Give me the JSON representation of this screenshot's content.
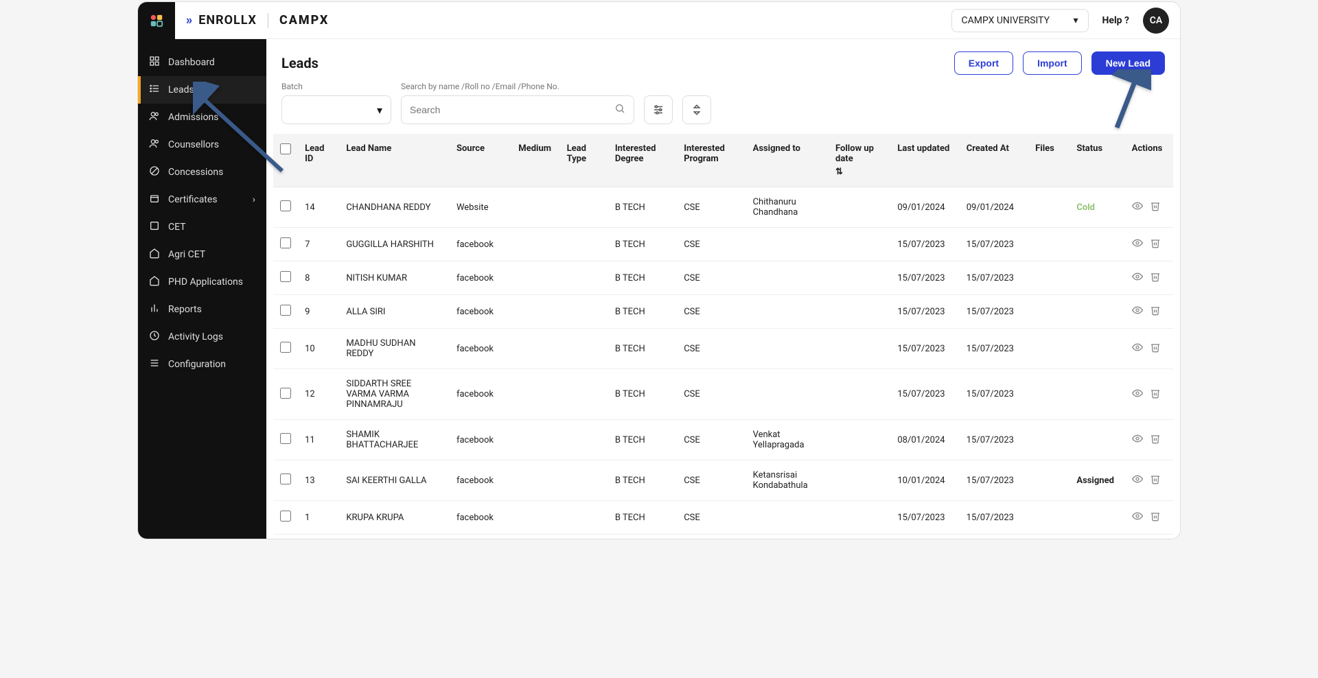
{
  "header": {
    "brand_prefix": "ENROLLX",
    "brand_suffix": "CAMPX",
    "university_label": "CAMPX UNIVERSITY",
    "help_label": "Help ?",
    "avatar_initials": "CA"
  },
  "sidebar": {
    "items": [
      {
        "label": "Dashboard",
        "icon": "grid"
      },
      {
        "label": "Leads",
        "icon": "list",
        "active": true
      },
      {
        "label": "Admissions",
        "icon": "users"
      },
      {
        "label": "Counsellors",
        "icon": "users"
      },
      {
        "label": "Concessions",
        "icon": "slash"
      },
      {
        "label": "Certificates",
        "icon": "box",
        "chevron": true
      },
      {
        "label": "CET",
        "icon": "square"
      },
      {
        "label": "Agri CET",
        "icon": "home"
      },
      {
        "label": "PHD Applications",
        "icon": "home"
      },
      {
        "label": "Reports",
        "icon": "bar"
      },
      {
        "label": "Activity Logs",
        "icon": "clock"
      },
      {
        "label": "Configuration",
        "icon": "sliders"
      }
    ]
  },
  "page": {
    "title": "Leads",
    "export_label": "Export",
    "import_label": "Import",
    "newlead_label": "New Lead"
  },
  "filters": {
    "batch_label": "Batch",
    "search_label": "Search by name /Roll no /Email /Phone No.",
    "search_placeholder": "Search"
  },
  "table": {
    "columns": [
      "",
      "Lead ID",
      "Lead Name",
      "Source",
      "Medium",
      "Lead Type",
      "Interested Degree",
      "Interested Program",
      "Assigned to",
      "Follow up date",
      "Last updated",
      "Created At",
      "Files",
      "Status",
      "Actions"
    ],
    "rows": [
      {
        "id": "14",
        "name": "CHANDHANA REDDY",
        "source": "Website",
        "medium": "",
        "type": "",
        "degree": "B TECH",
        "program": "CSE",
        "assigned": "Chithanuru Chandhana",
        "follow": "",
        "updated": "09/01/2024",
        "created": "09/01/2024",
        "files": "",
        "status": "Cold",
        "status_class": "status-cold"
      },
      {
        "id": "7",
        "name": "GUGGILLA HARSHITH",
        "source": "facebook",
        "medium": "",
        "type": "",
        "degree": "B TECH",
        "program": "CSE",
        "assigned": "",
        "follow": "",
        "updated": "15/07/2023",
        "created": "15/07/2023",
        "files": "",
        "status": "",
        "status_class": ""
      },
      {
        "id": "8",
        "name": "NITISH KUMAR",
        "source": "facebook",
        "medium": "",
        "type": "",
        "degree": "B TECH",
        "program": "CSE",
        "assigned": "",
        "follow": "",
        "updated": "15/07/2023",
        "created": "15/07/2023",
        "files": "",
        "status": "",
        "status_class": ""
      },
      {
        "id": "9",
        "name": "ALLA SIRI",
        "source": "facebook",
        "medium": "",
        "type": "",
        "degree": "B TECH",
        "program": "CSE",
        "assigned": "",
        "follow": "",
        "updated": "15/07/2023",
        "created": "15/07/2023",
        "files": "",
        "status": "",
        "status_class": ""
      },
      {
        "id": "10",
        "name": "MADHU SUDHAN REDDY",
        "source": "facebook",
        "medium": "",
        "type": "",
        "degree": "B TECH",
        "program": "CSE",
        "assigned": "",
        "follow": "",
        "updated": "15/07/2023",
        "created": "15/07/2023",
        "files": "",
        "status": "",
        "status_class": ""
      },
      {
        "id": "12",
        "name": "SIDDARTH SREE VARMA VARMA PINNAMRAJU",
        "source": "facebook",
        "medium": "",
        "type": "",
        "degree": "B TECH",
        "program": "CSE",
        "assigned": "",
        "follow": "",
        "updated": "15/07/2023",
        "created": "15/07/2023",
        "files": "",
        "status": "",
        "status_class": ""
      },
      {
        "id": "11",
        "name": "SHAMIK BHATTACHARJEE",
        "source": "facebook",
        "medium": "",
        "type": "",
        "degree": "B TECH",
        "program": "CSE",
        "assigned": "Venkat Yellapragada",
        "follow": "",
        "updated": "08/01/2024",
        "created": "15/07/2023",
        "files": "",
        "status": "",
        "status_class": ""
      },
      {
        "id": "13",
        "name": "SAI KEERTHI GALLA",
        "source": "facebook",
        "medium": "",
        "type": "",
        "degree": "B TECH",
        "program": "CSE",
        "assigned": "Ketansrisai Kondabathula",
        "follow": "",
        "updated": "10/01/2024",
        "created": "15/07/2023",
        "files": "",
        "status": "Assigned",
        "status_class": "status-assigned"
      },
      {
        "id": "1",
        "name": "KRUPA KRUPA",
        "source": "facebook",
        "medium": "",
        "type": "",
        "degree": "B TECH",
        "program": "CSE",
        "assigned": "",
        "follow": "",
        "updated": "15/07/2023",
        "created": "15/07/2023",
        "files": "",
        "status": "",
        "status_class": ""
      }
    ]
  }
}
